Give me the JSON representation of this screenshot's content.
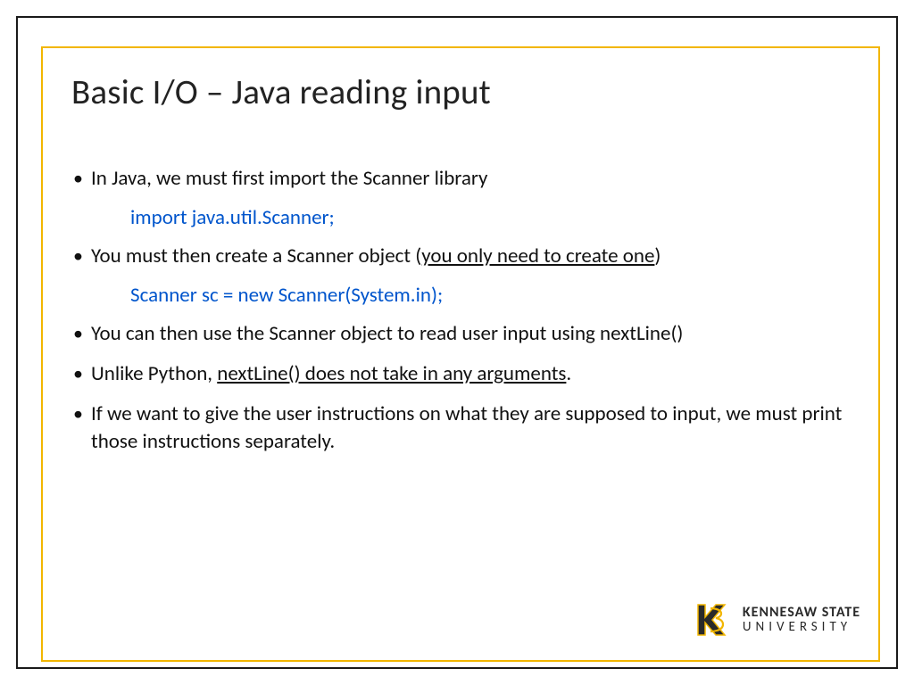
{
  "title": "Basic I/O – Java reading input",
  "bullets": {
    "b1": "In Java, we must first import the Scanner library",
    "code1": "import java.util.Scanner;",
    "b2_pre": "You must then create a Scanner object (",
    "b2_u": "you only need to create one",
    "b2_post": ")",
    "code2": "Scanner sc = new Scanner(System.in);",
    "b3": "You can then use the Scanner object to read user input using nextLine()",
    "b4_pre": "Unlike Python, ",
    "b4_u": "nextLine() does not take in any arguments",
    "b4_post": ".",
    "b5": "If we want to give the user instructions on what they are supposed to input, we must print those instructions separately."
  },
  "logo": {
    "line1": "KENNESAW STATE",
    "line2": "UNIVERSITY"
  },
  "colors": {
    "accent_gold": "#f2b600",
    "code_blue": "#0055cc",
    "text": "#111111"
  }
}
